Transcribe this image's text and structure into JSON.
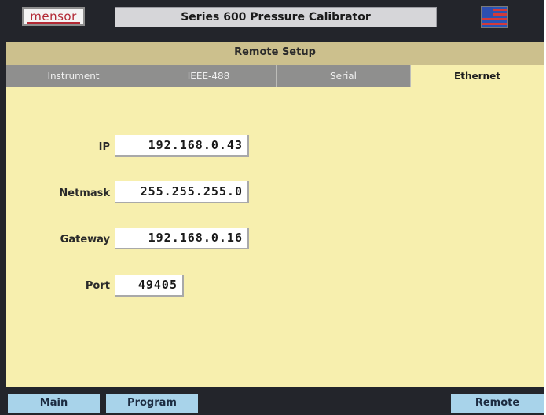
{
  "header": {
    "logo_text": "mensor",
    "title": "Series 600 Pressure Calibrator",
    "flag_icon": "us-flag-icon"
  },
  "screen": {
    "section_title": "Remote Setup",
    "tabs": [
      {
        "label": "Instrument",
        "active": false
      },
      {
        "label": "IEEE-488",
        "active": false
      },
      {
        "label": "Serial",
        "active": false
      },
      {
        "label": "Ethernet",
        "active": true
      }
    ],
    "fields": {
      "ip": {
        "label": "IP",
        "value": "192.168.0.43"
      },
      "netmask": {
        "label": "Netmask",
        "value": "255.255.255.0"
      },
      "gateway": {
        "label": "Gateway",
        "value": "192.168.0.16"
      },
      "port": {
        "label": "Port",
        "value": "49405"
      }
    }
  },
  "footer": {
    "main_label": "Main",
    "program_label": "Program",
    "remote_label": "Remote"
  },
  "colors": {
    "panel_background": "#f7efae",
    "section_header": "#ccc08d",
    "inactive_tab": "#8f8f8e",
    "bezel": "#23252b",
    "button": "#a8d3ea",
    "logo_red": "#b22834"
  }
}
